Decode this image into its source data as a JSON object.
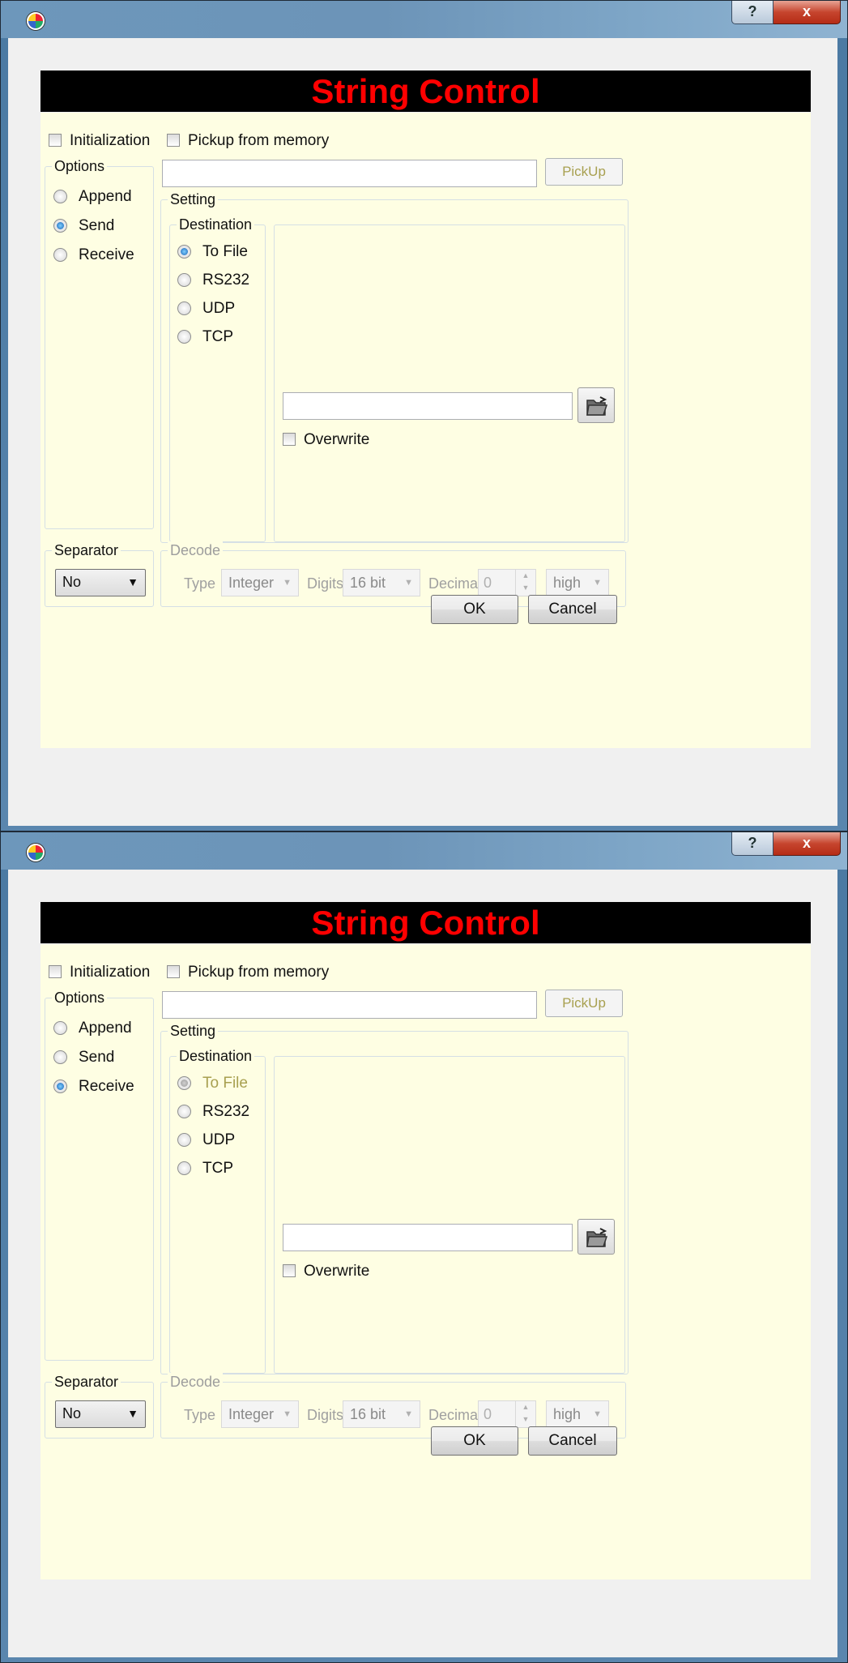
{
  "dialogs": [
    {
      "title_buttons": {
        "help": "?",
        "close": "x"
      },
      "banner": "String Control",
      "initialization_label": "Initialization",
      "pickup_label": "Pickup from memory",
      "pickup_button": "PickUp",
      "options_title": "Options",
      "options": [
        "Append",
        "Send",
        "Receive"
      ],
      "options_selected": "Send",
      "setting_title": "Setting",
      "destination_title": "Destination",
      "destinations": [
        "To File",
        "RS232",
        "UDP",
        "TCP"
      ],
      "destination_selected": "To File",
      "overwrite_label": "Overwrite",
      "separator_title": "Separator",
      "separator_value": "No",
      "decode_title": "Decode",
      "type_label": "Type",
      "type_value": "Integer",
      "digits_label": "Digits",
      "digits_value": "16 bit",
      "decimal_label": "Decimal",
      "decimal_value": "0",
      "endian_value": "high",
      "ok_button": "OK",
      "cancel_button": "Cancel"
    },
    {
      "title_buttons": {
        "help": "?",
        "close": "x"
      },
      "banner": "String Control",
      "initialization_label": "Initialization",
      "pickup_label": "Pickup from memory",
      "pickup_button": "PickUp",
      "options_title": "Options",
      "options": [
        "Append",
        "Send",
        "Receive"
      ],
      "options_selected": "Receive",
      "setting_title": "Setting",
      "destination_title": "Destination",
      "destinations": [
        "To File",
        "RS232",
        "UDP",
        "TCP"
      ],
      "destination_selected": "To File",
      "overwrite_label": "Overwrite",
      "separator_title": "Separator",
      "separator_value": "No",
      "decode_title": "Decode",
      "type_label": "Type",
      "type_value": "Integer",
      "digits_label": "Digits",
      "digits_value": "16 bit",
      "decimal_label": "Decimal",
      "decimal_value": "0",
      "endian_value": "high",
      "ok_button": "OK",
      "cancel_button": "Cancel"
    }
  ],
  "colors": {
    "banner_bg": "#000000",
    "banner_text": "#ff0000",
    "panel_bg": "#fefee3",
    "radio_selected": "#1660b5",
    "radio_disabled": "#9a9a9a",
    "disabled_text": "#a8a050"
  },
  "icons": [
    "app-icon",
    "help-icon",
    "close-icon",
    "folder-open-icon",
    "dropdown-arrow-icon",
    "spin-arrows-icon"
  ]
}
